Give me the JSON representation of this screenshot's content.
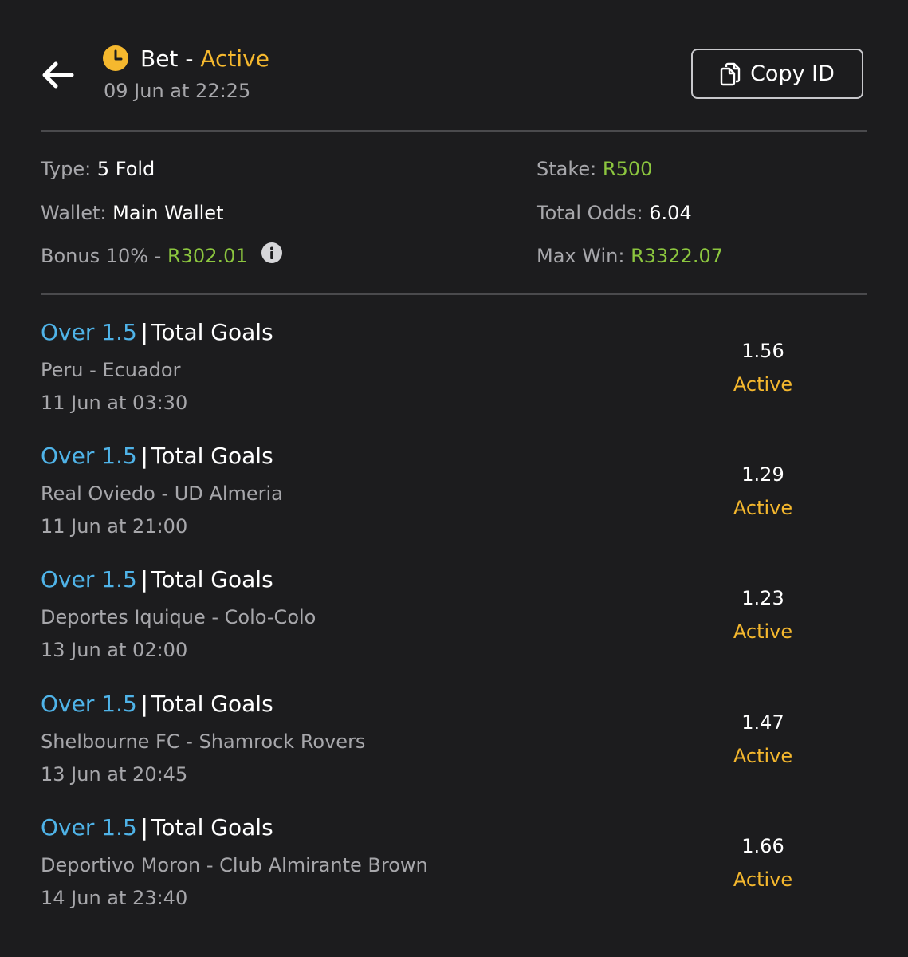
{
  "header": {
    "title": "Bet",
    "separator": "-",
    "status": "Active",
    "placed_time": "09 Jun at 22:25",
    "copy_label": "Copy ID"
  },
  "summary": {
    "type_label": "Type:",
    "type_value": "5 Fold",
    "wallet_label": "Wallet:",
    "wallet_value": "Main Wallet",
    "bonus_label": "Bonus 10% -",
    "bonus_value": "R302.01",
    "stake_label": "Stake:",
    "stake_value": "R500",
    "odds_label": "Total Odds:",
    "odds_value": "6.04",
    "maxwin_label": "Max Win:",
    "maxwin_value": "R3322.07"
  },
  "selections": [
    {
      "pick": "Over 1.5",
      "market": "Total Goals",
      "event": "Peru - Ecuador",
      "time": "11 Jun at 03:30",
      "odds": "1.56",
      "status": "Active"
    },
    {
      "pick": "Over 1.5",
      "market": "Total Goals",
      "event": "Real Oviedo - UD Almeria",
      "time": "11 Jun at 21:00",
      "odds": "1.29",
      "status": "Active"
    },
    {
      "pick": "Over 1.5",
      "market": "Total Goals",
      "event": "Deportes Iquique - Colo-Colo",
      "time": "13 Jun at 02:00",
      "odds": "1.23",
      "status": "Active"
    },
    {
      "pick": "Over 1.5",
      "market": "Total Goals",
      "event": "Shelbourne FC - Shamrock Rovers",
      "time": "13 Jun at 20:45",
      "odds": "1.47",
      "status": "Active"
    },
    {
      "pick": "Over 1.5",
      "market": "Total Goals",
      "event": "Deportivo Moron - Club Almirante Brown",
      "time": "14 Jun at 23:40",
      "odds": "1.66",
      "status": "Active"
    }
  ],
  "colors": {
    "background": "#1c1c1e",
    "accent_yellow": "#f5b82e",
    "money_green": "#8cc63f",
    "pick_blue": "#4fb3e8",
    "muted_text": "#a7a7ab"
  },
  "icons": {
    "back": "arrow-left-icon",
    "status": "clock-icon",
    "copy": "copy-icon",
    "info": "info-icon"
  }
}
